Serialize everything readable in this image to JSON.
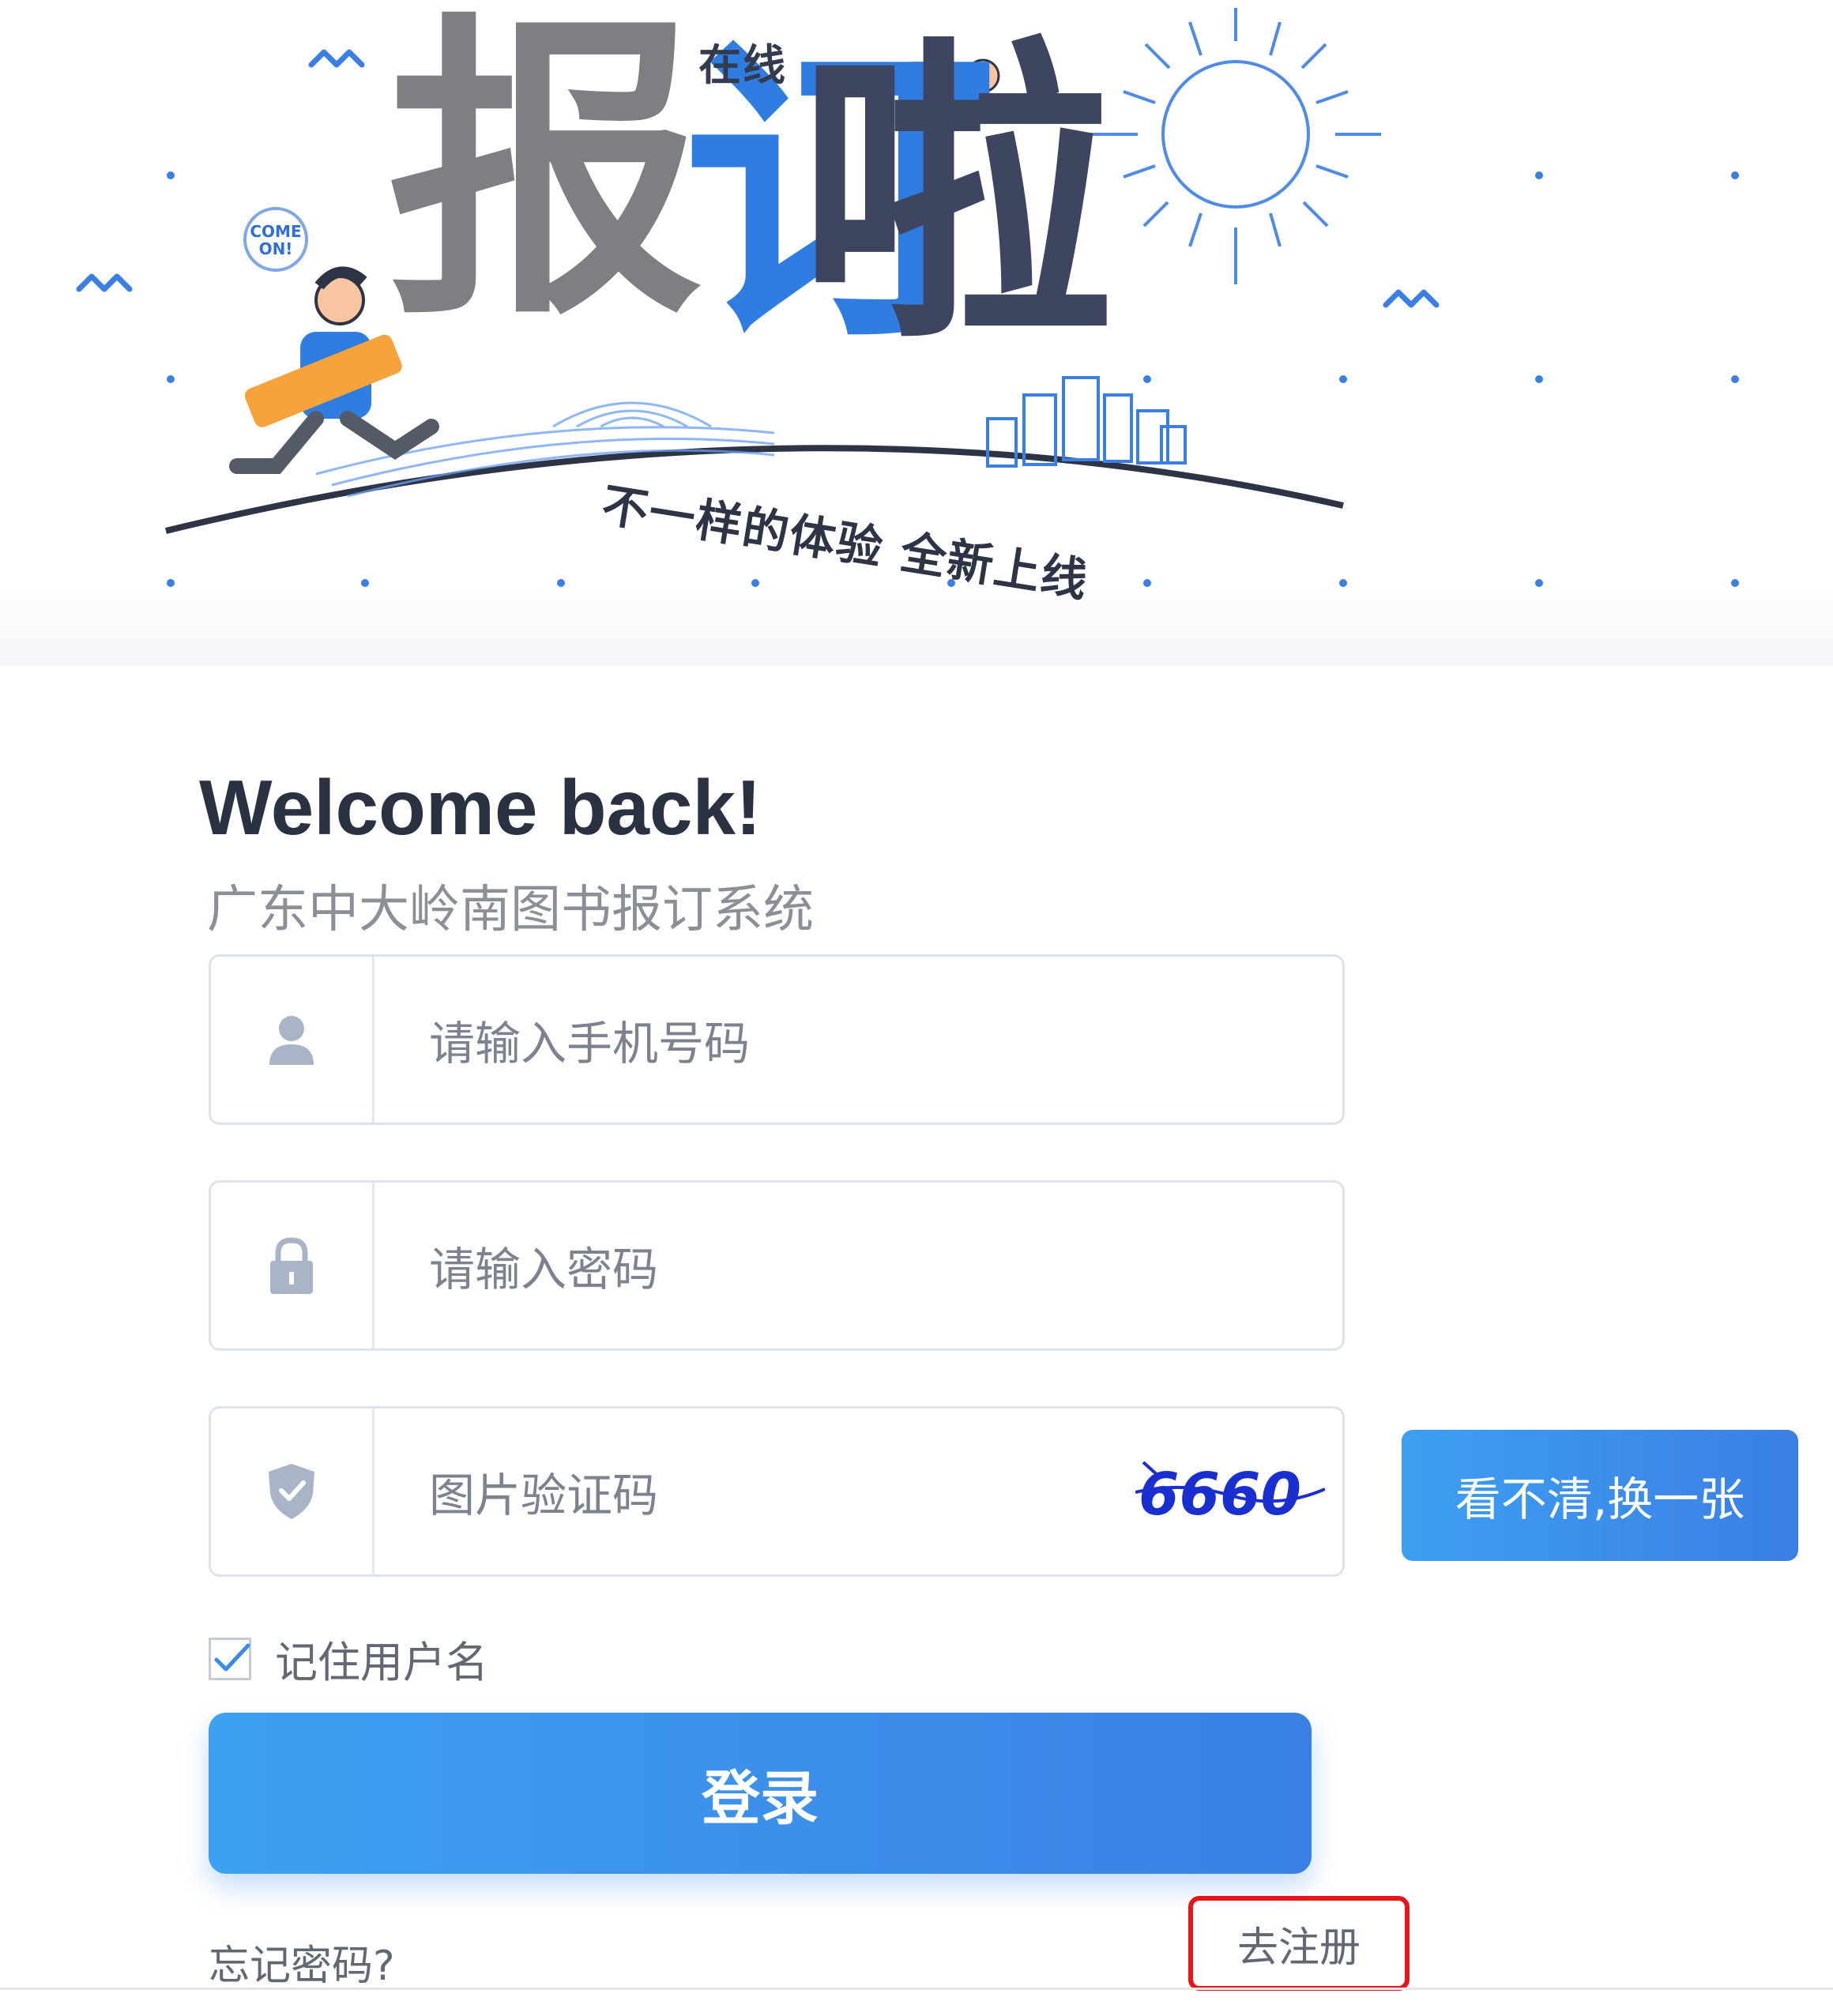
{
  "banner": {
    "title_part1": "报",
    "title_part2": "订",
    "title_part3": "啦",
    "online": "在线",
    "tagline": "不一样的体验 全新上线",
    "bubble": "COME ON!"
  },
  "login": {
    "heading": "Welcome back!",
    "subtitle": "广东中大岭南图书报订系统",
    "phone_placeholder": "请输入手机号码",
    "password_placeholder": "请输入密码",
    "captcha_placeholder": "图片验证码",
    "captcha_text": "6660",
    "refresh_captcha": "看不清,换一张",
    "remember_label": "记住用户名",
    "remember_checked": true,
    "submit": "登录",
    "forgot": "忘记密码?",
    "register": "去注册"
  },
  "colors": {
    "accent": "#3b8ae8",
    "highlight_border": "#e8161a",
    "text_muted": "#7c8290"
  }
}
